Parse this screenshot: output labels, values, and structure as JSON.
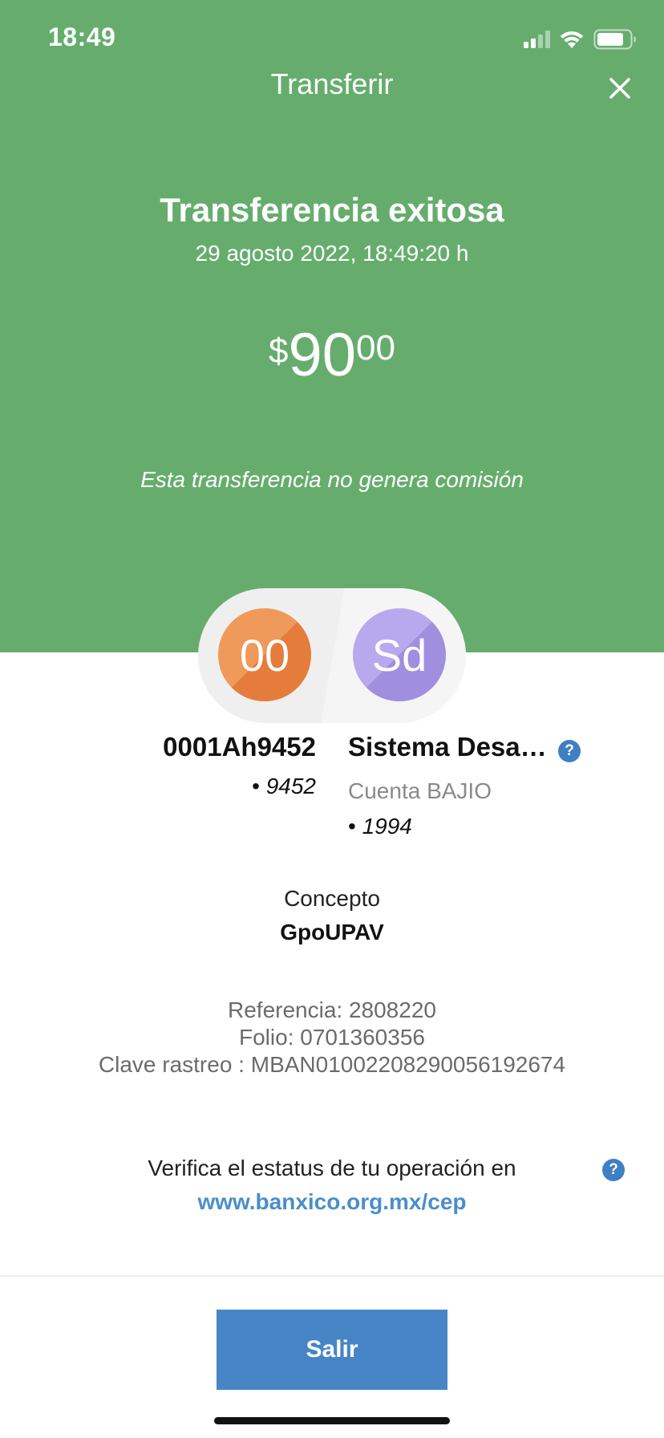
{
  "status_bar": {
    "time": "18:49"
  },
  "header": {
    "title": "Transferir"
  },
  "result": {
    "title": "Transferencia exitosa",
    "datetime": "29 agosto 2022, 18:49:20 h",
    "amount_currency": "$",
    "amount_integer": "90",
    "amount_decimal": "00",
    "commission_note": "Esta transferencia no genera comisión"
  },
  "origin": {
    "avatar_initials": "00",
    "name": "0001Ah9452",
    "account": "9452"
  },
  "destination": {
    "avatar_initials": "Sd",
    "name": "Sistema Desarr...",
    "bank": "Cuenta BAJIO",
    "account": "1994"
  },
  "bullet": "•",
  "concept": {
    "label": "Concepto",
    "value": "GpoUPAV"
  },
  "references": {
    "referencia": "Referencia: 2808220",
    "folio": "Folio: 0701360356",
    "clave_rastreo": "Clave rastreo : MBAN01002208290056192674"
  },
  "verify": {
    "text": "Verifica el estatus de tu operación en",
    "link": "www.banxico.org.mx/cep"
  },
  "help_glyph": "?",
  "footer": {
    "exit_label": "Salir"
  },
  "colors": {
    "header_green": "#66ad6d",
    "primary_blue": "#4785c7",
    "link_blue": "#4a8ec9",
    "origin_avatar": "#e57c3c",
    "destination_avatar": "#a08edf"
  }
}
